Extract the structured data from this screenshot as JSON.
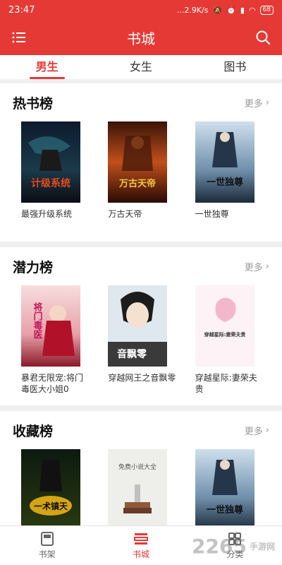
{
  "status": {
    "time": "23:47",
    "speed": "...2.9K/s",
    "battery": "68"
  },
  "appbar": {
    "title": "书城"
  },
  "tabs": [
    {
      "label": "男生",
      "active": true
    },
    {
      "label": "女生",
      "active": false
    },
    {
      "label": "图书",
      "active": false
    }
  ],
  "sections": [
    {
      "title": "热书榜",
      "more": "更多",
      "books": [
        {
          "name": "最强升级系统",
          "cover_text": "计级系统"
        },
        {
          "name": "万古天帝",
          "cover_text": "万古天帝"
        },
        {
          "name": "一世独尊",
          "cover_text": "一世独尊"
        }
      ]
    },
    {
      "title": "潜力榜",
      "more": "更多",
      "books": [
        {
          "name": "暴君无限宠:将门毒医大小姐0",
          "cover_text": "将门毒医"
        },
        {
          "name": "穿越网王之音飘零",
          "cover_text": "音飘零"
        },
        {
          "name": "穿越星际:妻荣夫贵",
          "cover_text": "穿越星际:妻荣夫贵"
        }
      ]
    },
    {
      "title": "收藏榜",
      "more": "更多",
      "books": [
        {
          "name": "",
          "cover_text": "一术镇天"
        },
        {
          "name": "",
          "cover_text": "免费小说大全"
        },
        {
          "name": "",
          "cover_text": "一世独尊"
        }
      ]
    }
  ],
  "bottom_nav": [
    {
      "label": "书架",
      "active": false
    },
    {
      "label": "书城",
      "active": true
    },
    {
      "label": "分类",
      "active": false
    }
  ],
  "watermark": {
    "brand": "2265",
    "site": "手游网"
  },
  "colors": {
    "accent": "#e53935"
  }
}
